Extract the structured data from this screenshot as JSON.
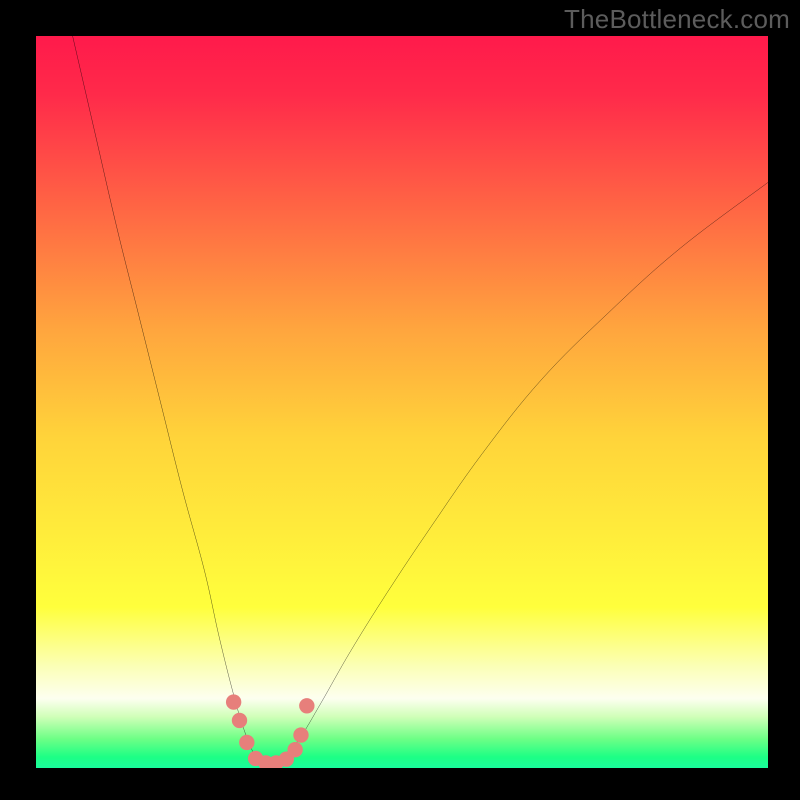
{
  "watermark": "TheBottleneck.com",
  "colors": {
    "frame": "#000000",
    "watermark": "#5c5c5c",
    "curve": "#000000",
    "dots": "#e77f7b",
    "gradient_stops": [
      {
        "offset": 0,
        "color": "#ff1a4b"
      },
      {
        "offset": 0.08,
        "color": "#ff2a4a"
      },
      {
        "offset": 0.4,
        "color": "#ffa53e"
      },
      {
        "offset": 0.55,
        "color": "#ffd43a"
      },
      {
        "offset": 0.78,
        "color": "#ffff3c"
      },
      {
        "offset": 0.86,
        "color": "#fbffb5"
      },
      {
        "offset": 0.905,
        "color": "#fdfff0"
      },
      {
        "offset": 0.93,
        "color": "#d0ffb8"
      },
      {
        "offset": 0.96,
        "color": "#6eff86"
      },
      {
        "offset": 0.985,
        "color": "#1dff85"
      },
      {
        "offset": 1.0,
        "color": "#1afc9c"
      }
    ]
  },
  "chart_data": {
    "type": "line",
    "title": "",
    "xlabel": "",
    "ylabel": "",
    "xlim": [
      0,
      100
    ],
    "ylim": [
      0,
      100
    ],
    "grid": false,
    "notes": "Bottleneck curve: two branches meeting at a rounded valley at ~x=31. Background vertical gradient encodes bottleneck severity (red high, green low). Salmon dots along the valley mark near-zero bottleneck points.",
    "series": [
      {
        "name": "left-branch",
        "x": [
          5,
          8,
          11,
          14,
          17,
          20,
          23,
          25,
          27,
          28.5,
          30
        ],
        "y": [
          100,
          87,
          74,
          62,
          50,
          38,
          27,
          18,
          10,
          5,
          1.5
        ]
      },
      {
        "name": "right-branch",
        "x": [
          34,
          36,
          39,
          43,
          48,
          54,
          61,
          69,
          78,
          88,
          100
        ],
        "y": [
          1.8,
          4,
          9,
          16,
          24,
          33,
          43,
          53,
          62,
          71,
          80
        ]
      },
      {
        "name": "valley-floor",
        "x": [
          30,
          31,
          32,
          33,
          34
        ],
        "y": [
          1.5,
          0.7,
          0.5,
          0.8,
          1.8
        ]
      }
    ],
    "valley_dots": [
      {
        "x": 27.0,
        "y": 9.0
      },
      {
        "x": 27.8,
        "y": 6.5
      },
      {
        "x": 28.8,
        "y": 3.5
      },
      {
        "x": 30.0,
        "y": 1.3
      },
      {
        "x": 31.4,
        "y": 0.7
      },
      {
        "x": 32.8,
        "y": 0.7
      },
      {
        "x": 34.2,
        "y": 1.2
      },
      {
        "x": 35.4,
        "y": 2.5
      },
      {
        "x": 36.2,
        "y": 4.5
      },
      {
        "x": 37.0,
        "y": 8.5
      }
    ]
  }
}
